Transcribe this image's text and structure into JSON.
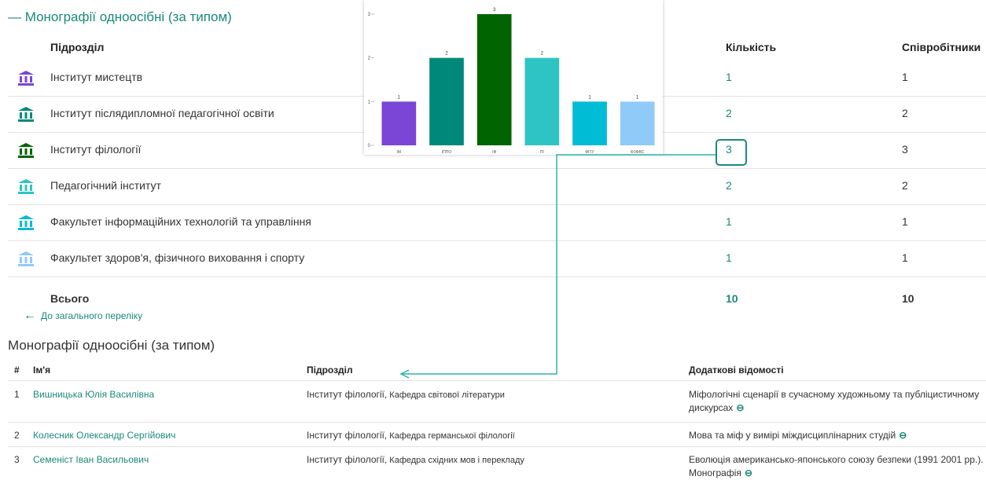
{
  "section": {
    "title": "— Монографії одноосібні (за типом)",
    "headers": {
      "unit": "Підрозділ",
      "count": "Кількість",
      "employees": "Співробітники"
    }
  },
  "rows": [
    {
      "name": "Інститут мистецтв",
      "count": "1",
      "employees": "1",
      "icon_color": "#7b45d6"
    },
    {
      "name": "Інститут післядипломної педагогічної освіти",
      "count": "2",
      "employees": "2",
      "icon_color": "#00897b"
    },
    {
      "name": "Інститут філології",
      "count": "3",
      "employees": "3",
      "icon_color": "#006400"
    },
    {
      "name": "Педагогічний інститут",
      "count": "2",
      "employees": "2",
      "icon_color": "#2ec4c4"
    },
    {
      "name": "Факультет інформаційних технологій та управління",
      "count": "1",
      "employees": "1",
      "icon_color": "#00bcd4"
    },
    {
      "name": "Факультет здоров'я, фізичного виховання і спорту",
      "count": "1",
      "employees": "1",
      "icon_color": "#90caf9"
    }
  ],
  "total": {
    "label": "Всього",
    "count": "10",
    "employees": "10"
  },
  "back_link": "До загального переліку",
  "list": {
    "title": "Монографії одноосібні (за типом)",
    "headers": {
      "num": "#",
      "name": "Ім'я",
      "unit": "Підрозділ",
      "info": "Додаткові відомості"
    },
    "items": [
      {
        "num": "1",
        "name": "Вишницька Юлія Василівна",
        "unit": "Інститут філології,",
        "dept": "Кафедра світової літератури",
        "info": "Міфологічні сценарії в сучасному художньому та публіцистичному дискурсах"
      },
      {
        "num": "2",
        "name": "Колесник Олександр Сергійович",
        "unit": "Інститут філології,",
        "dept": "Кафедра германської філології",
        "info": "Мова та міф у вимірі міждисциплінарних студій"
      },
      {
        "num": "3",
        "name": "Семеніст Іван Васильович",
        "unit": "Інститут філології,",
        "dept": "Кафедра східних мов і перекладу",
        "info": "Еволюція американсько-японського союзу безпеки (1991 2001 рр.). Монографія"
      }
    ]
  },
  "chart_data": {
    "type": "bar",
    "categories": [
      "ІМ",
      "ІППО",
      "ІФ",
      "ПІ",
      "ФІТУ",
      "ФЗФВС"
    ],
    "values": [
      1,
      2,
      3,
      2,
      1,
      1
    ],
    "colors": [
      "#7b45d6",
      "#00897b",
      "#006400",
      "#2ec4c4",
      "#00bcd4",
      "#90caf9"
    ],
    "yticks": [
      0,
      1,
      2,
      3
    ],
    "ylim": [
      0,
      3
    ],
    "grid": false,
    "legend": "none"
  }
}
